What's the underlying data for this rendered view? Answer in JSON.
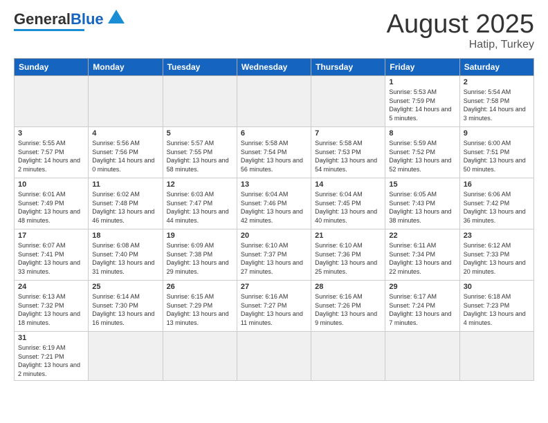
{
  "header": {
    "logo_general": "General",
    "logo_blue": "Blue",
    "month_year": "August 2025",
    "location": "Hatip, Turkey"
  },
  "days_of_week": [
    "Sunday",
    "Monday",
    "Tuesday",
    "Wednesday",
    "Thursday",
    "Friday",
    "Saturday"
  ],
  "weeks": [
    [
      {
        "day": "",
        "info": ""
      },
      {
        "day": "",
        "info": ""
      },
      {
        "day": "",
        "info": ""
      },
      {
        "day": "",
        "info": ""
      },
      {
        "day": "",
        "info": ""
      },
      {
        "day": "1",
        "info": "Sunrise: 5:53 AM\nSunset: 7:59 PM\nDaylight: 14 hours\nand 5 minutes."
      },
      {
        "day": "2",
        "info": "Sunrise: 5:54 AM\nSunset: 7:58 PM\nDaylight: 14 hours\nand 3 minutes."
      }
    ],
    [
      {
        "day": "3",
        "info": "Sunrise: 5:55 AM\nSunset: 7:57 PM\nDaylight: 14 hours\nand 2 minutes."
      },
      {
        "day": "4",
        "info": "Sunrise: 5:56 AM\nSunset: 7:56 PM\nDaylight: 14 hours\nand 0 minutes."
      },
      {
        "day": "5",
        "info": "Sunrise: 5:57 AM\nSunset: 7:55 PM\nDaylight: 13 hours\nand 58 minutes."
      },
      {
        "day": "6",
        "info": "Sunrise: 5:58 AM\nSunset: 7:54 PM\nDaylight: 13 hours\nand 56 minutes."
      },
      {
        "day": "7",
        "info": "Sunrise: 5:58 AM\nSunset: 7:53 PM\nDaylight: 13 hours\nand 54 minutes."
      },
      {
        "day": "8",
        "info": "Sunrise: 5:59 AM\nSunset: 7:52 PM\nDaylight: 13 hours\nand 52 minutes."
      },
      {
        "day": "9",
        "info": "Sunrise: 6:00 AM\nSunset: 7:51 PM\nDaylight: 13 hours\nand 50 minutes."
      }
    ],
    [
      {
        "day": "10",
        "info": "Sunrise: 6:01 AM\nSunset: 7:49 PM\nDaylight: 13 hours\nand 48 minutes."
      },
      {
        "day": "11",
        "info": "Sunrise: 6:02 AM\nSunset: 7:48 PM\nDaylight: 13 hours\nand 46 minutes."
      },
      {
        "day": "12",
        "info": "Sunrise: 6:03 AM\nSunset: 7:47 PM\nDaylight: 13 hours\nand 44 minutes."
      },
      {
        "day": "13",
        "info": "Sunrise: 6:04 AM\nSunset: 7:46 PM\nDaylight: 13 hours\nand 42 minutes."
      },
      {
        "day": "14",
        "info": "Sunrise: 6:04 AM\nSunset: 7:45 PM\nDaylight: 13 hours\nand 40 minutes."
      },
      {
        "day": "15",
        "info": "Sunrise: 6:05 AM\nSunset: 7:43 PM\nDaylight: 13 hours\nand 38 minutes."
      },
      {
        "day": "16",
        "info": "Sunrise: 6:06 AM\nSunset: 7:42 PM\nDaylight: 13 hours\nand 36 minutes."
      }
    ],
    [
      {
        "day": "17",
        "info": "Sunrise: 6:07 AM\nSunset: 7:41 PM\nDaylight: 13 hours\nand 33 minutes."
      },
      {
        "day": "18",
        "info": "Sunrise: 6:08 AM\nSunset: 7:40 PM\nDaylight: 13 hours\nand 31 minutes."
      },
      {
        "day": "19",
        "info": "Sunrise: 6:09 AM\nSunset: 7:38 PM\nDaylight: 13 hours\nand 29 minutes."
      },
      {
        "day": "20",
        "info": "Sunrise: 6:10 AM\nSunset: 7:37 PM\nDaylight: 13 hours\nand 27 minutes."
      },
      {
        "day": "21",
        "info": "Sunrise: 6:10 AM\nSunset: 7:36 PM\nDaylight: 13 hours\nand 25 minutes."
      },
      {
        "day": "22",
        "info": "Sunrise: 6:11 AM\nSunset: 7:34 PM\nDaylight: 13 hours\nand 22 minutes."
      },
      {
        "day": "23",
        "info": "Sunrise: 6:12 AM\nSunset: 7:33 PM\nDaylight: 13 hours\nand 20 minutes."
      }
    ],
    [
      {
        "day": "24",
        "info": "Sunrise: 6:13 AM\nSunset: 7:32 PM\nDaylight: 13 hours\nand 18 minutes."
      },
      {
        "day": "25",
        "info": "Sunrise: 6:14 AM\nSunset: 7:30 PM\nDaylight: 13 hours\nand 16 minutes."
      },
      {
        "day": "26",
        "info": "Sunrise: 6:15 AM\nSunset: 7:29 PM\nDaylight: 13 hours\nand 13 minutes."
      },
      {
        "day": "27",
        "info": "Sunrise: 6:16 AM\nSunset: 7:27 PM\nDaylight: 13 hours\nand 11 minutes."
      },
      {
        "day": "28",
        "info": "Sunrise: 6:16 AM\nSunset: 7:26 PM\nDaylight: 13 hours\nand 9 minutes."
      },
      {
        "day": "29",
        "info": "Sunrise: 6:17 AM\nSunset: 7:24 PM\nDaylight: 13 hours\nand 7 minutes."
      },
      {
        "day": "30",
        "info": "Sunrise: 6:18 AM\nSunset: 7:23 PM\nDaylight: 13 hours\nand 4 minutes."
      }
    ],
    [
      {
        "day": "31",
        "info": "Sunrise: 6:19 AM\nSunset: 7:21 PM\nDaylight: 13 hours\nand 2 minutes."
      },
      {
        "day": "",
        "info": ""
      },
      {
        "day": "",
        "info": ""
      },
      {
        "day": "",
        "info": ""
      },
      {
        "day": "",
        "info": ""
      },
      {
        "day": "",
        "info": ""
      },
      {
        "day": "",
        "info": ""
      }
    ]
  ]
}
